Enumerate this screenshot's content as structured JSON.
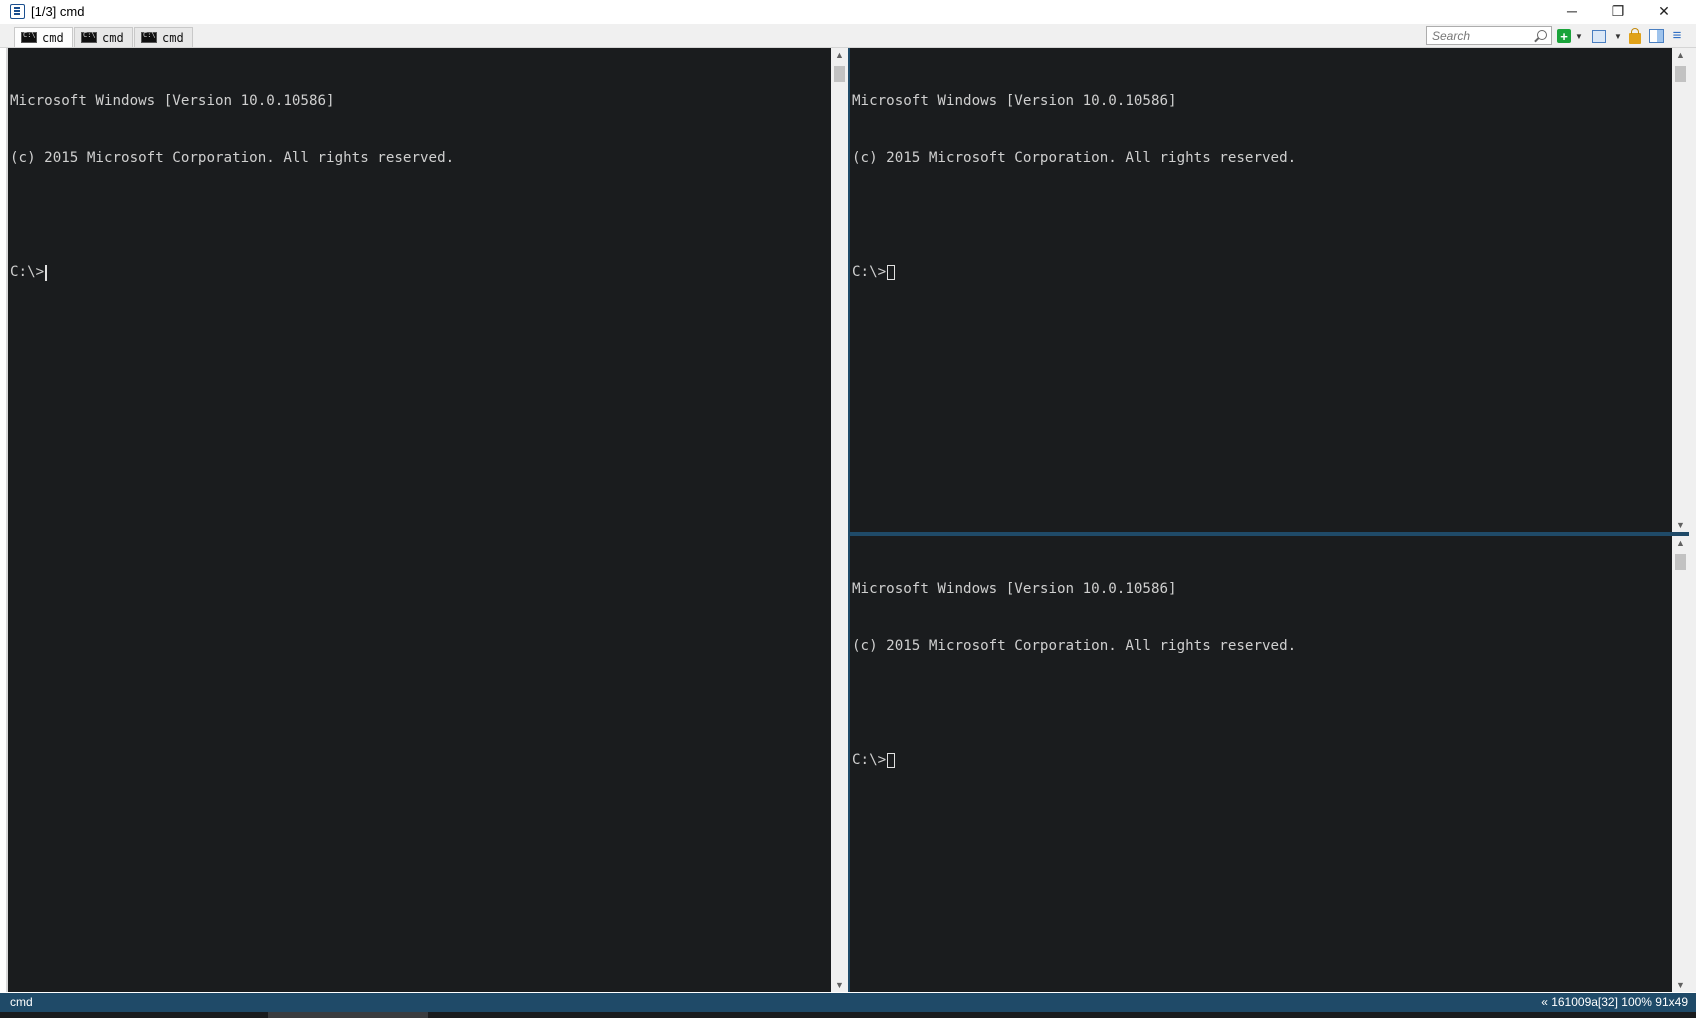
{
  "window": {
    "title": "[1/3] cmd",
    "minimize_glyph": "─",
    "maximize_glyph": "❐",
    "close_glyph": "✕"
  },
  "tabs": [
    {
      "label": "cmd",
      "active": true
    },
    {
      "label": "cmd",
      "active": false
    },
    {
      "label": "cmd",
      "active": false
    }
  ],
  "toolbar": {
    "search_placeholder": "Search",
    "add_glyph": "+",
    "dropdown_glyph": "▼",
    "menu_glyph": "≡"
  },
  "panes": {
    "left": {
      "lines": [
        "Microsoft Windows [Version 10.0.10586]",
        "(c) 2015 Microsoft Corporation. All rights reserved.",
        ""
      ],
      "prompt": "C:\\>"
    },
    "right_top": {
      "lines": [
        "Microsoft Windows [Version 10.0.10586]",
        "(c) 2015 Microsoft Corporation. All rights reserved.",
        ""
      ],
      "prompt": "C:\\>"
    },
    "right_bottom": {
      "lines": [
        "Microsoft Windows [Version 10.0.10586]",
        "(c) 2015 Microsoft Corporation. All rights reserved.",
        ""
      ],
      "prompt": "C:\\>"
    }
  },
  "scroll": {
    "up_glyph": "▲",
    "down_glyph": "▼"
  },
  "status": {
    "left": "cmd",
    "right": "« 161009a[32] 100% 91x49"
  },
  "colors": {
    "terminal_bg": "#1a1c1e",
    "terminal_fg": "#cfcfcf",
    "accent": "#1f4a68"
  }
}
